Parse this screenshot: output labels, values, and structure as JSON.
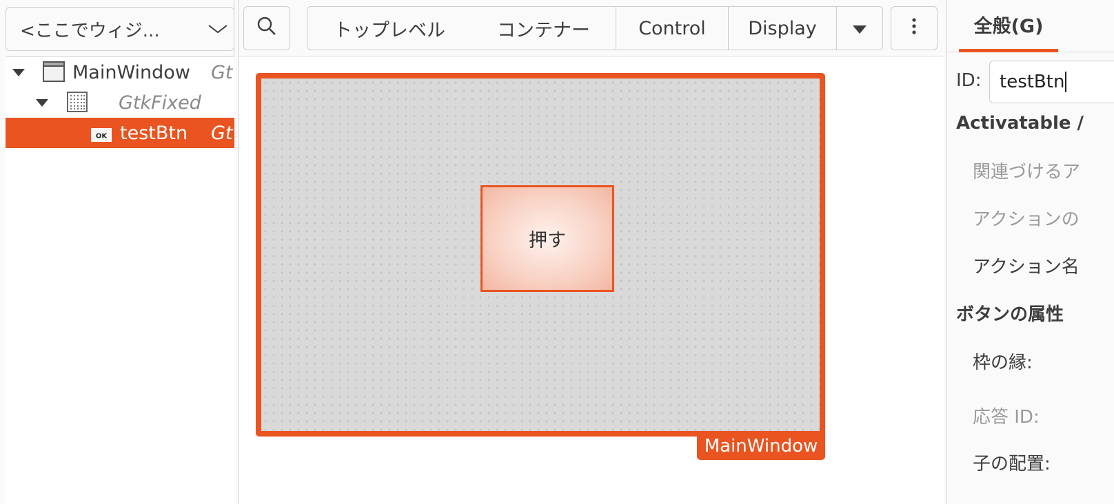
{
  "left_panel": {
    "widget_combo": {
      "text": "<ここでウィジ..."
    },
    "tree": [
      {
        "name": "MainWindow",
        "class": "Gt",
        "icon": "window-icon",
        "expanded": true
      },
      {
        "name": "",
        "class": "GtkFixed",
        "icon": "fixed-grid-icon",
        "expanded": true
      },
      {
        "name": "testBtn",
        "class": "Gt",
        "icon": "button-ok-icon",
        "selected": true,
        "icon_text": "OK"
      }
    ]
  },
  "toolbar": {
    "search_icon": "search-icon",
    "categories": [
      "トップレベル",
      "コンテナー",
      "Control",
      "Display"
    ],
    "more_icon": "triangle-down-icon",
    "menu_icon": "vertical-dots-icon"
  },
  "canvas": {
    "window_label": "MainWindow",
    "button_label": "押す"
  },
  "properties": {
    "tab_label": "全般(G)",
    "id_label": "ID:",
    "id_value": "testBtn",
    "activatable_heading": "Activatable /",
    "related_action": "関連づけるア",
    "action_target": "アクションの",
    "action_name": "アクション名",
    "button_attrs_heading": "ボタンの属性",
    "border_label": "枠の縁:",
    "response_id_label": "応答 ID:",
    "child_layout_label": "子の配置:"
  },
  "colors": {
    "accent": "#e95420",
    "canvas_bg": "#d9d9d9"
  }
}
